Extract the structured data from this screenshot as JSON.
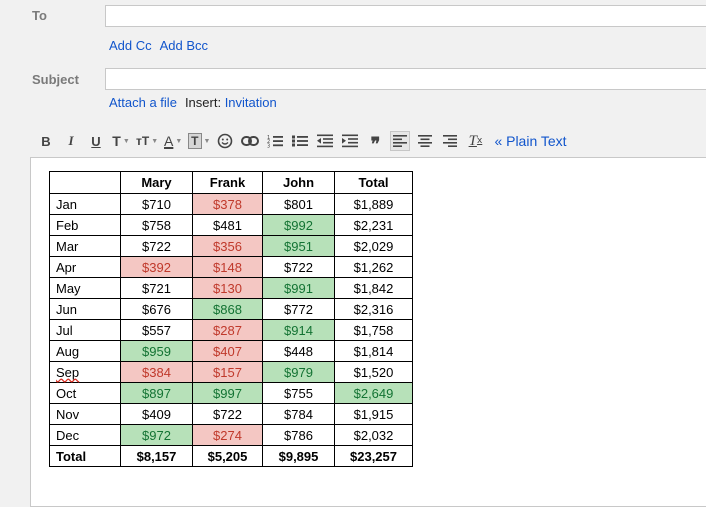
{
  "to": {
    "label": "To",
    "value": ""
  },
  "cc_links": {
    "add_cc": "Add Cc",
    "add_bcc": "Add Bcc"
  },
  "subject": {
    "label": "Subject",
    "value": ""
  },
  "attach": {
    "attach_file": "Attach a file",
    "insert_label": "Insert:",
    "invitation": "Invitation"
  },
  "toolbar": {
    "bold": "B",
    "italic": "I",
    "underline": "U",
    "font": "T",
    "size": "тT",
    "text_color": "A",
    "highlight": "T",
    "plain_text": "« Plain Text",
    "buttons": [
      "bold-icon",
      "italic-icon",
      "underline-icon",
      "font-icon",
      "text-size-icon",
      "text-color-icon",
      "highlight-icon",
      "emoji-icon",
      "link-icon",
      "numbered-list-icon",
      "bulleted-list-icon",
      "indent-less-icon",
      "indent-more-icon",
      "quote-icon",
      "align-left-icon",
      "align-center-icon",
      "align-right-icon",
      "remove-formatting-icon"
    ]
  },
  "table": {
    "headers": [
      "",
      "Mary",
      "Frank",
      "John",
      "Total"
    ],
    "rows": [
      [
        "Jan",
        "$710",
        "$378",
        "$801",
        "$1,889"
      ],
      [
        "Feb",
        "$758",
        "$481",
        "$992",
        "$2,231"
      ],
      [
        "Mar",
        "$722",
        "$356",
        "$951",
        "$2,029"
      ],
      [
        "Apr",
        "$392",
        "$148",
        "$722",
        "$1,262"
      ],
      [
        "May",
        "$721",
        "$130",
        "$991",
        "$1,842"
      ],
      [
        "Jun",
        "$676",
        "$868",
        "$772",
        "$2,316"
      ],
      [
        "Jul",
        "$557",
        "$287",
        "$914",
        "$1,758"
      ],
      [
        "Aug",
        "$959",
        "$407",
        "$448",
        "$1,814"
      ],
      [
        "Sep",
        "$384",
        "$157",
        "$979",
        "$1,520"
      ],
      [
        "Oct",
        "$897",
        "$997",
        "$755",
        "$2,649"
      ],
      [
        "Nov",
        "$409",
        "$722",
        "$784",
        "$1,915"
      ],
      [
        "Dec",
        "$972",
        "$274",
        "$786",
        "$2,032"
      ]
    ],
    "total_row": [
      "Total",
      "$8,157",
      "$5,205",
      "$9,895",
      "$23,257"
    ],
    "colors": {
      "red_fill": "#f4c7c3",
      "red_text": "#c0392b",
      "green_fill": "#b7e1b9",
      "green_text": "#137333"
    }
  }
}
